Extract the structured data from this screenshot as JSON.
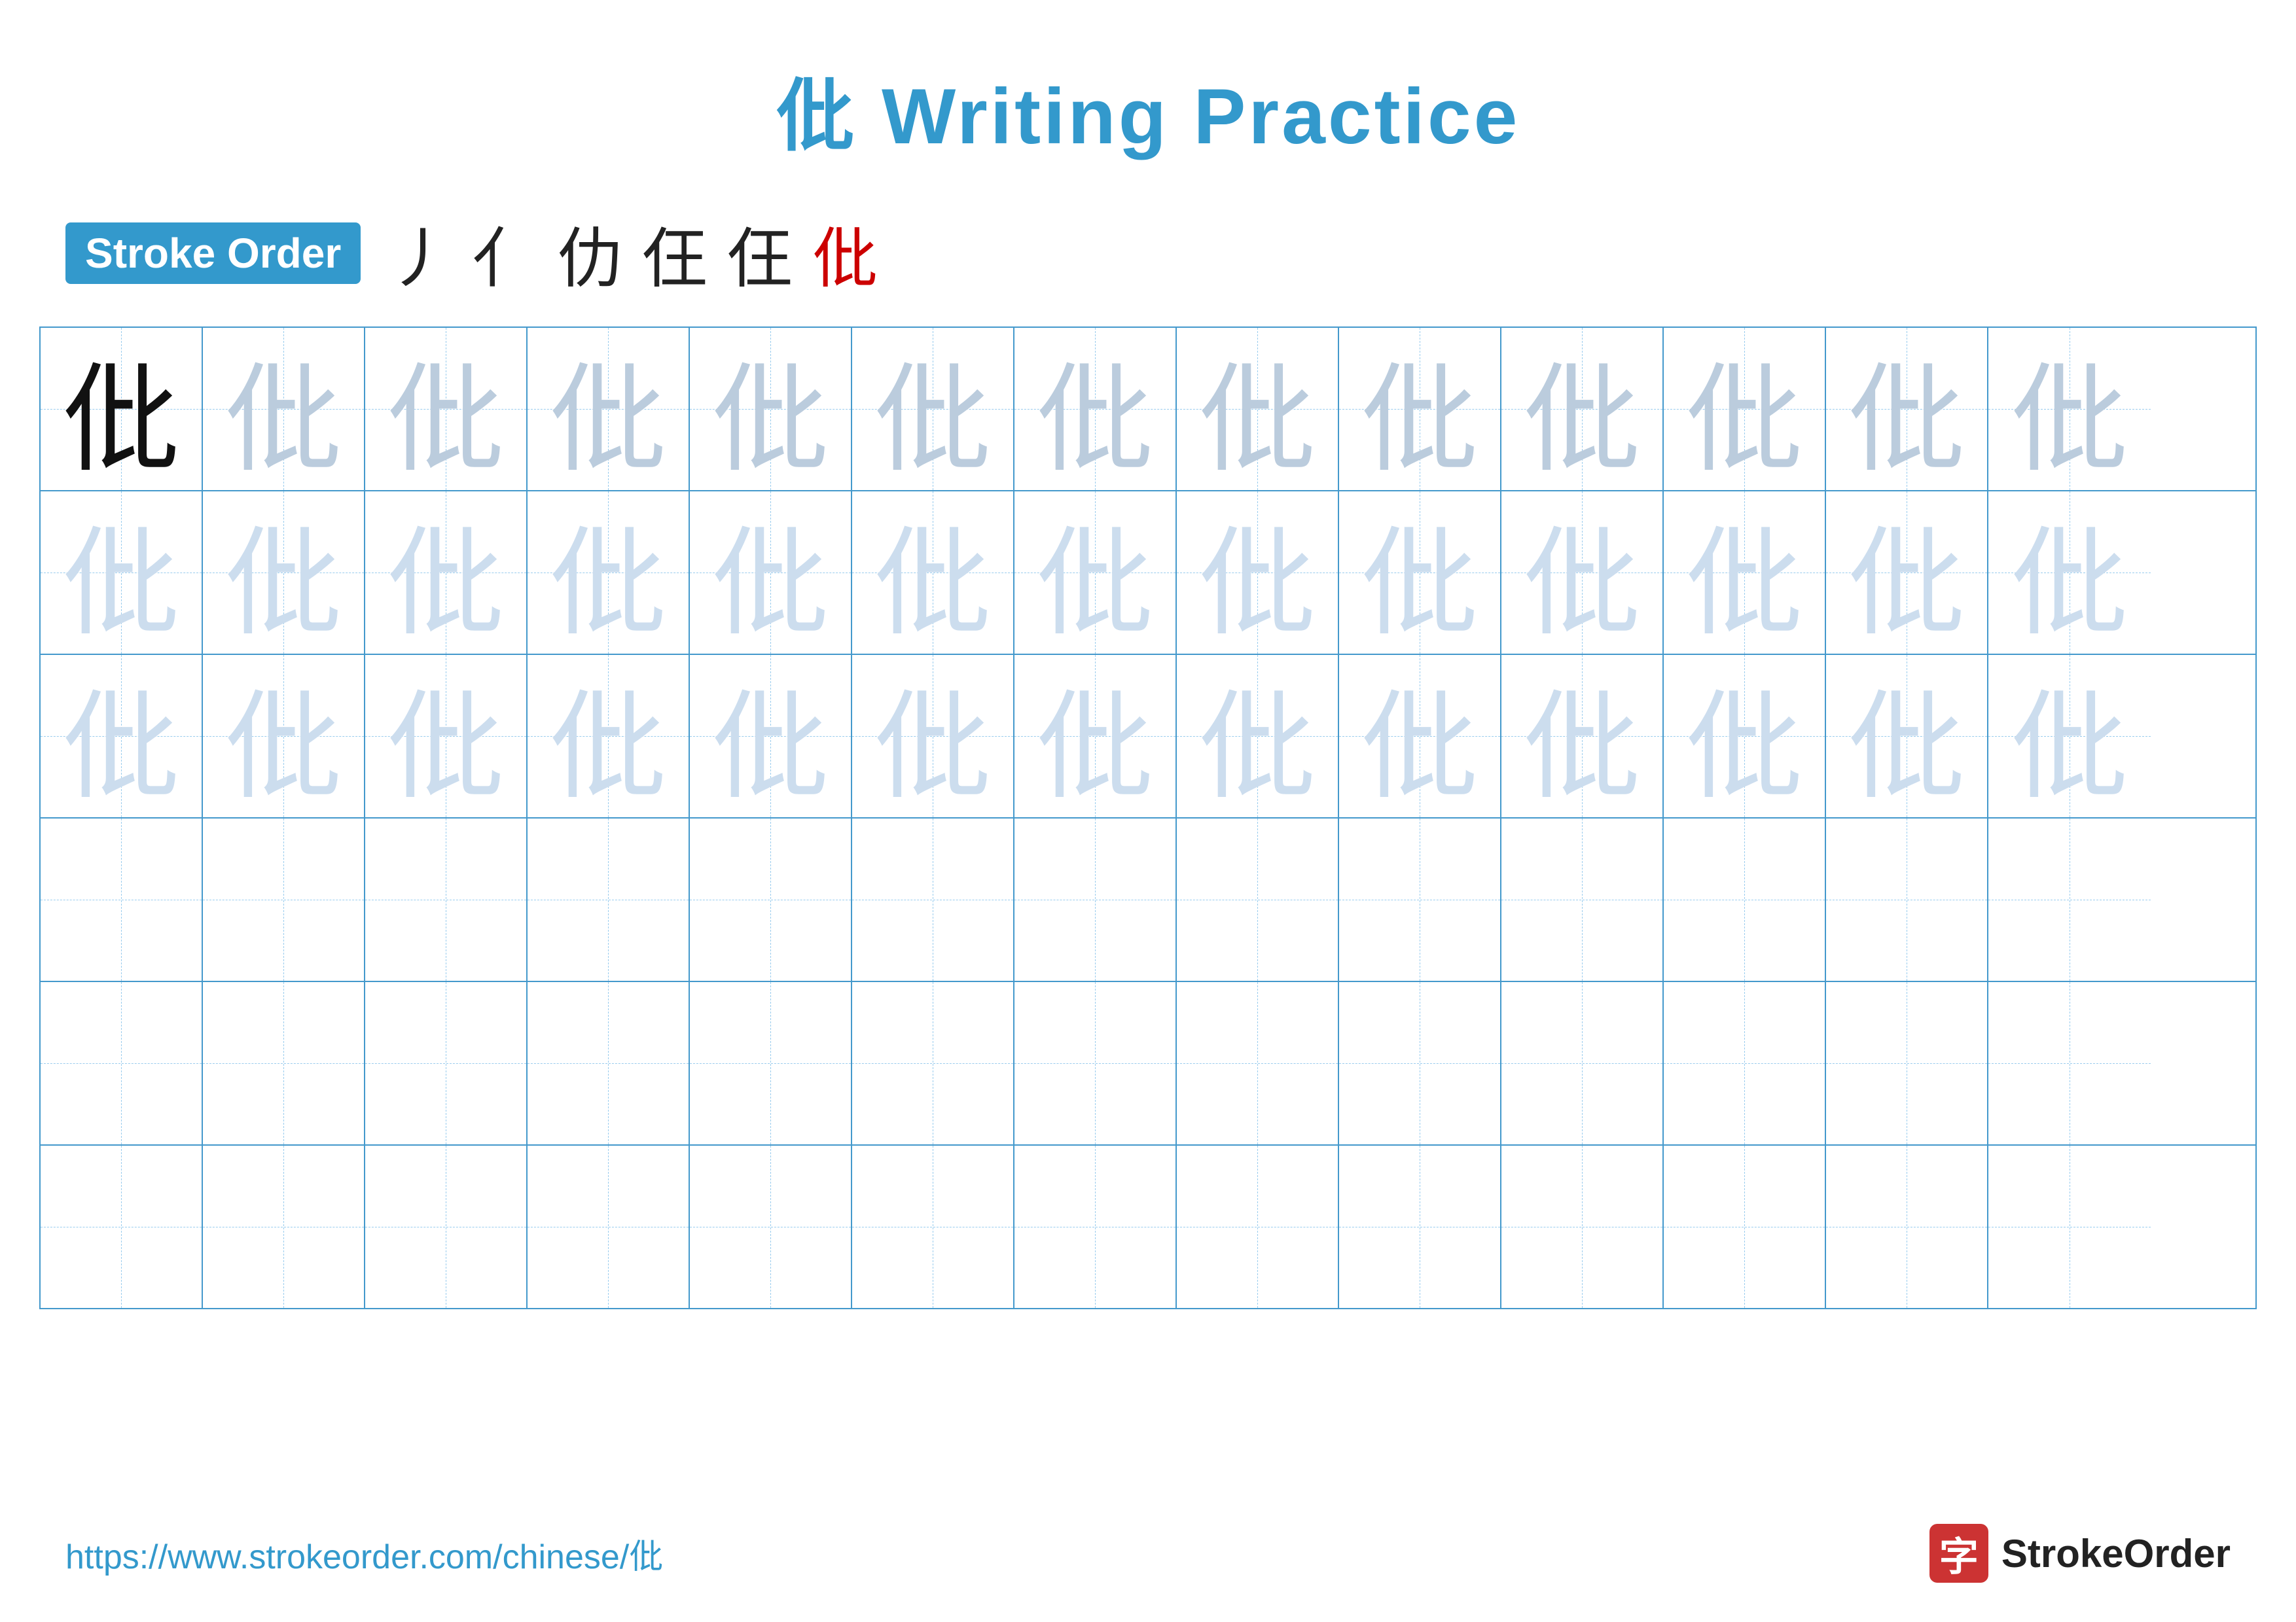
{
  "title": "仳 Writing Practice",
  "stroke_order": {
    "badge_label": "Stroke Order",
    "strokes": [
      "丿",
      "亻",
      "仳",
      "仳",
      "仳",
      "仳"
    ]
  },
  "character": "仳",
  "grid": {
    "rows": 6,
    "cols": 13,
    "row_data": [
      {
        "chars": [
          "dark",
          "light1",
          "light1",
          "light1",
          "light1",
          "light1",
          "light1",
          "light1",
          "light1",
          "light1",
          "light1",
          "light1",
          "light1"
        ]
      },
      {
        "chars": [
          "light2",
          "light2",
          "light2",
          "light2",
          "light2",
          "light2",
          "light2",
          "light2",
          "light2",
          "light2",
          "light2",
          "light2",
          "light2"
        ]
      },
      {
        "chars": [
          "light2",
          "light2",
          "light2",
          "light2",
          "light2",
          "light2",
          "light2",
          "light2",
          "light2",
          "light2",
          "light2",
          "light2",
          "light2"
        ]
      },
      {
        "chars": [
          "empty",
          "empty",
          "empty",
          "empty",
          "empty",
          "empty",
          "empty",
          "empty",
          "empty",
          "empty",
          "empty",
          "empty",
          "empty"
        ]
      },
      {
        "chars": [
          "empty",
          "empty",
          "empty",
          "empty",
          "empty",
          "empty",
          "empty",
          "empty",
          "empty",
          "empty",
          "empty",
          "empty",
          "empty"
        ]
      },
      {
        "chars": [
          "empty",
          "empty",
          "empty",
          "empty",
          "empty",
          "empty",
          "empty",
          "empty",
          "empty",
          "empty",
          "empty",
          "empty",
          "empty"
        ]
      }
    ]
  },
  "footer": {
    "url": "https://www.strokeorder.com/chinese/仳",
    "logo_char": "字",
    "logo_text": "StrokeOrder"
  }
}
